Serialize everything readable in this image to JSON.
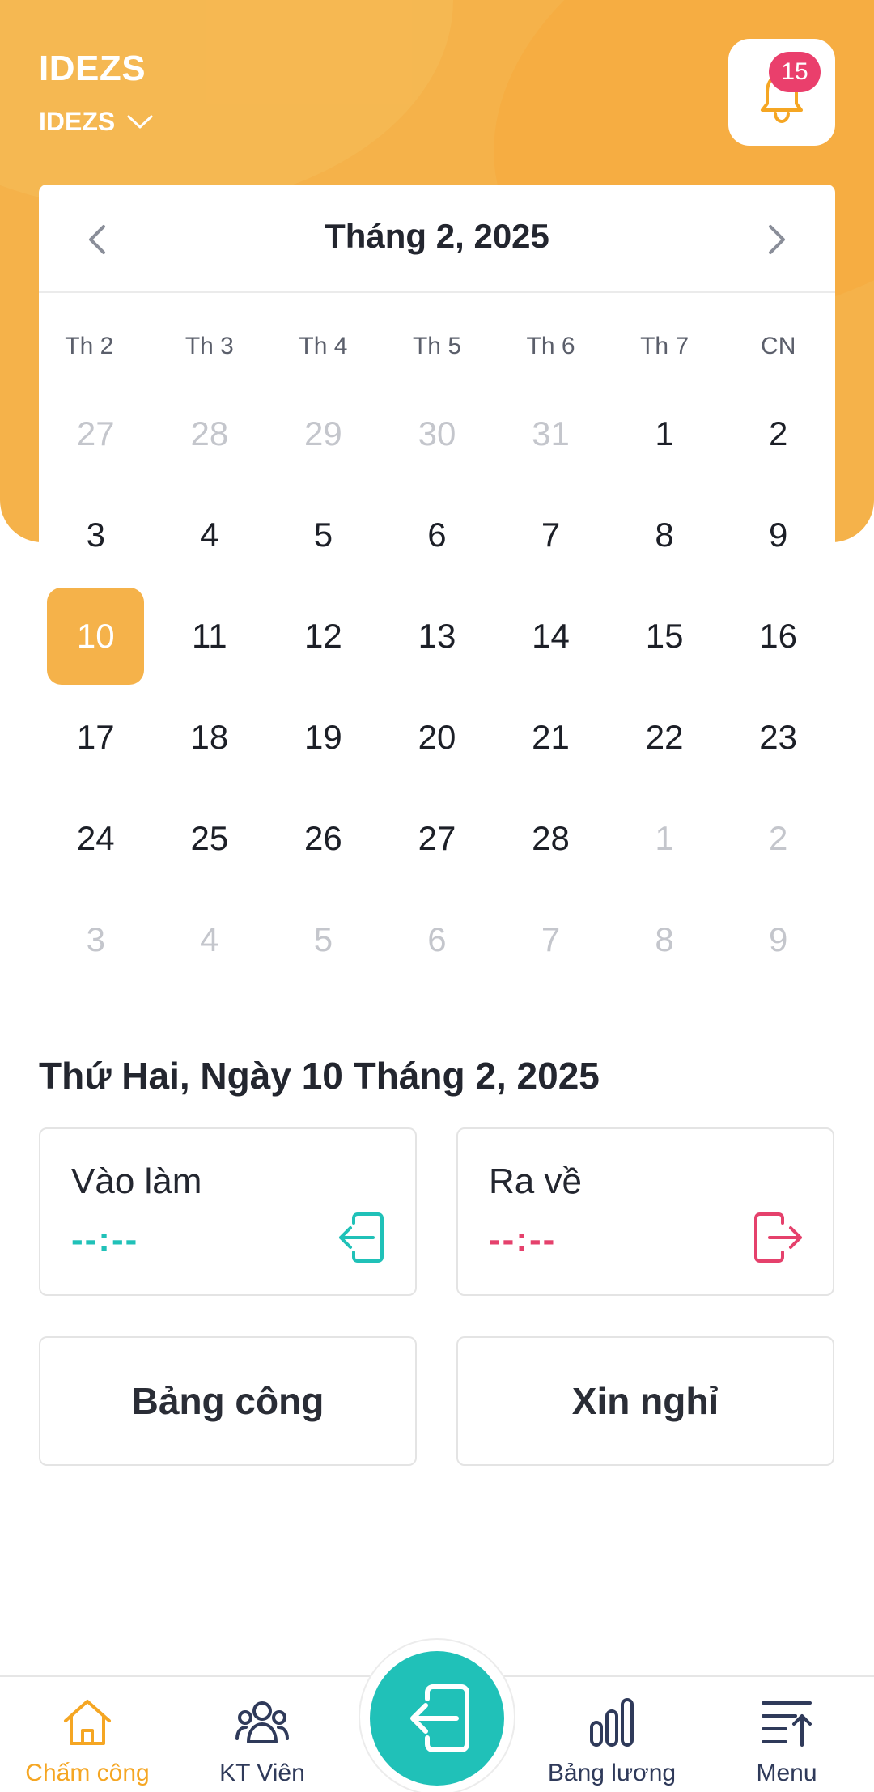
{
  "header": {
    "brand": "IDEZS",
    "company": "IDEZS",
    "notification_count": "15",
    "accent_color": "#f5b24a"
  },
  "calendar": {
    "title": "Tháng 2, 2025",
    "weekdays": [
      "Th 2",
      "Th 3",
      "Th 4",
      "Th 5",
      "Th 6",
      "Th 7",
      "CN"
    ],
    "days": [
      {
        "d": "27",
        "muted": true
      },
      {
        "d": "28",
        "muted": true
      },
      {
        "d": "29",
        "muted": true
      },
      {
        "d": "30",
        "muted": true
      },
      {
        "d": "31",
        "muted": true
      },
      {
        "d": "1"
      },
      {
        "d": "2"
      },
      {
        "d": "3"
      },
      {
        "d": "4"
      },
      {
        "d": "5"
      },
      {
        "d": "6"
      },
      {
        "d": "7"
      },
      {
        "d": "8"
      },
      {
        "d": "9"
      },
      {
        "d": "10",
        "selected": true
      },
      {
        "d": "11"
      },
      {
        "d": "12"
      },
      {
        "d": "13"
      },
      {
        "d": "14"
      },
      {
        "d": "15"
      },
      {
        "d": "16"
      },
      {
        "d": "17"
      },
      {
        "d": "18"
      },
      {
        "d": "19"
      },
      {
        "d": "20"
      },
      {
        "d": "21"
      },
      {
        "d": "22"
      },
      {
        "d": "23"
      },
      {
        "d": "24"
      },
      {
        "d": "25"
      },
      {
        "d": "26"
      },
      {
        "d": "27"
      },
      {
        "d": "28"
      },
      {
        "d": "1",
        "muted": true
      },
      {
        "d": "2",
        "muted": true
      },
      {
        "d": "3",
        "muted": true
      },
      {
        "d": "4",
        "muted": true
      },
      {
        "d": "5",
        "muted": true
      },
      {
        "d": "6",
        "muted": true
      },
      {
        "d": "7",
        "muted": true
      },
      {
        "d": "8",
        "muted": true
      },
      {
        "d": "9",
        "muted": true
      }
    ]
  },
  "selected_date_label": "Thứ Hai, Ngày 10 Tháng 2, 2025",
  "attendance": {
    "check_in": {
      "label": "Vào làm",
      "time": "--:--",
      "color": "#20c1b8"
    },
    "check_out": {
      "label": "Ra về",
      "time": "--:--",
      "color": "#e5416c"
    }
  },
  "actions": {
    "timesheet": "Bảng công",
    "leave": "Xin nghỉ"
  },
  "bottom_nav": {
    "home": "Chấm công",
    "staff": "KT Viên",
    "salary": "Bảng lương",
    "menu": "Menu"
  }
}
